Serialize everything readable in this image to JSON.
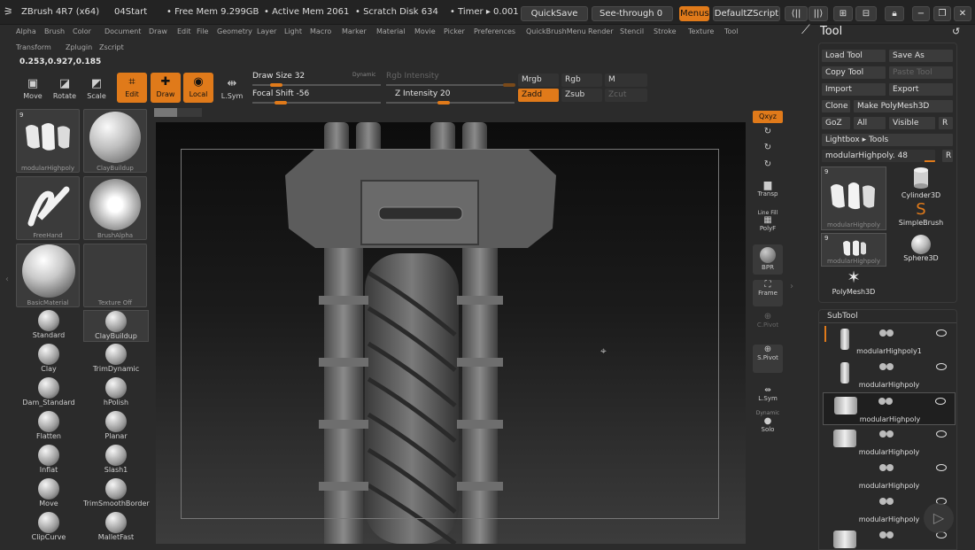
{
  "titlebar": {
    "app": "ZBrush 4R7 (x64)",
    "doc": "04Start",
    "free_mem": "• Free Mem 9.299GB",
    "active_mem": "• Active Mem 2061",
    "scratch": "• Scratch Disk 634",
    "timer": "• Timer ▸ 0.001",
    "quicksave": "QuickSave",
    "see_through": "See-through  0",
    "menus": "Menus",
    "default_zscript": "DefaultZScript"
  },
  "menubar": [
    "Alpha",
    "Brush",
    "Color",
    "Document",
    "Draw",
    "Edit",
    "File",
    "Geometry",
    "Layer",
    "Light",
    "Macro",
    "Marker",
    "Material",
    "Movie",
    "Picker",
    "Preferences",
    "QuickBrushMenu",
    "Render",
    "Stencil",
    "Stroke",
    "Texture",
    "Tool"
  ],
  "menubar2": [
    "Transform",
    "Zplugin",
    "Zscript"
  ],
  "coords": "0.253,0.927,0.185",
  "toolbar": {
    "move": "Move",
    "rotate": "Rotate",
    "scale": "Scale",
    "edit": "Edit",
    "draw": "Draw",
    "local": "Local",
    "lsym": "L.Sym",
    "draw_size": "Draw Size 32",
    "dynamic": "Dynamic",
    "focal_shift": "Focal Shift -56",
    "rgb_intensity": "Rgb Intensity",
    "z_intensity": "Z Intensity 20",
    "mrgb": "Mrgb",
    "rgb": "Rgb",
    "m": "M",
    "zadd": "Zadd",
    "zsub": "Zsub",
    "zcut": "Zcut"
  },
  "palette_tiles": [
    {
      "label": "modularHighpoly",
      "badge": "9"
    },
    {
      "label": "ClayBuildup"
    },
    {
      "label": "FreeHand"
    },
    {
      "label": "BrushAlpha"
    },
    {
      "label": "BasicMaterial"
    },
    {
      "label": "Texture Off"
    }
  ],
  "brushes": [
    "Standard",
    "ClayBuildup",
    "Clay",
    "TrimDynamic",
    "Dam_Standard",
    "hPolish",
    "Flatten",
    "Planar",
    "Inflat",
    "Slash1",
    "Move",
    "TrimSmoothBorder",
    "ClipCurve",
    "MalletFast"
  ],
  "shelf": {
    "xyz": "Qxyz",
    "transp": "Transp",
    "linefill": "Line Fill",
    "polyf": "PolyF",
    "bpr": "BPR",
    "frame": "Frame",
    "cpivot": "C.Pivot",
    "spivot": "S.Pivot",
    "lsym": "L.Sym",
    "dynamic": "Dynamic",
    "solo": "Solo"
  },
  "tool_panel": {
    "title": "Tool",
    "load_tool": "Load Tool",
    "save_as": "Save As",
    "copy_tool": "Copy Tool",
    "paste_tool": "Paste Tool",
    "import": "Import",
    "export": "Export",
    "clone": "Clone",
    "make_polymesh": "Make PolyMesh3D",
    "goz": "GoZ",
    "all": "All",
    "visible": "Visible",
    "r": "R",
    "lightbox": "Lightbox ▸ Tools",
    "current_tool": "modularHighpoly. 48",
    "items": [
      {
        "label": "modularHighpoly",
        "badge": "9"
      },
      {
        "label": "Cylinder3D"
      },
      {
        "label": "SimpleBrush"
      },
      {
        "label": "modularHighpoly",
        "badge": "9"
      },
      {
        "label": "Sphere3D"
      },
      {
        "label": "PolyMesh3D"
      }
    ]
  },
  "subtool": {
    "title": "SubTool",
    "rows": [
      "modularHighpoly1",
      "modularHighpoly",
      "modularHighpoly",
      "modularHighpoly",
      "modularHighpoly",
      "modularHighpoly",
      ""
    ]
  },
  "colors": {
    "accent": "#e07a1a",
    "panel": "#2a2a2a",
    "bg": "#2b2b2b"
  }
}
